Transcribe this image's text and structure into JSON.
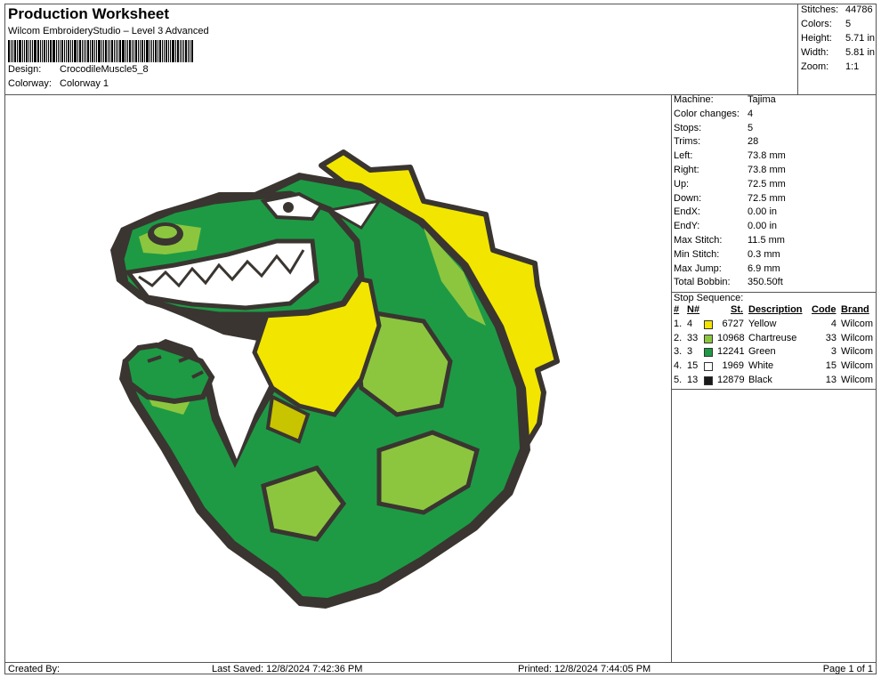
{
  "header": {
    "title": "Production Worksheet",
    "subtitle": "Wilcom EmbroideryStudio – Level 3 Advanced",
    "design_label": "Design:",
    "design_value": "CrocodileMuscle5_8",
    "colorway_label": "Colorway:",
    "colorway_value": "Colorway 1"
  },
  "stats": [
    {
      "label": "Stitches:",
      "value": "44786"
    },
    {
      "label": "Colors:",
      "value": "5"
    },
    {
      "label": "Height:",
      "value": "5.71 in"
    },
    {
      "label": "Width:",
      "value": "5.81 in"
    },
    {
      "label": "Zoom:",
      "value": "1:1"
    }
  ],
  "properties": [
    {
      "label": "Machine:",
      "value": "Tajima"
    },
    {
      "label": "Color changes:",
      "value": "4"
    },
    {
      "label": "Stops:",
      "value": "5"
    },
    {
      "label": "Trims:",
      "value": "28"
    },
    {
      "label": "Left:",
      "value": "73.8 mm"
    },
    {
      "label": "Right:",
      "value": "73.8 mm"
    },
    {
      "label": "Up:",
      "value": "72.5 mm"
    },
    {
      "label": "Down:",
      "value": "72.5 mm"
    },
    {
      "label": "EndX:",
      "value": "0.00 in"
    },
    {
      "label": "EndY:",
      "value": "0.00 in"
    },
    {
      "label": "Max Stitch:",
      "value": "11.5 mm"
    },
    {
      "label": "Min Stitch:",
      "value": "0.3 mm"
    },
    {
      "label": "Max Jump:",
      "value": "6.9 mm"
    },
    {
      "label": "Total Bobbin:",
      "value": "350.50ft"
    }
  ],
  "stop_sequence": {
    "title": "Stop Sequence:",
    "headers": {
      "num": "#",
      "n": "N#",
      "st": "St.",
      "desc": "Description",
      "code": "Code",
      "brand": "Brand"
    },
    "rows": [
      {
        "num": "1.",
        "n": "4",
        "color": "#f2e600",
        "st": "6727",
        "desc": "Yellow",
        "code": "4",
        "brand": "Wilcom"
      },
      {
        "num": "2.",
        "n": "33",
        "color": "#8cc63f",
        "st": "10968",
        "desc": "Chartreuse",
        "code": "33",
        "brand": "Wilcom"
      },
      {
        "num": "3.",
        "n": "3",
        "color": "#1e9a45",
        "st": "12241",
        "desc": "Green",
        "code": "3",
        "brand": "Wilcom"
      },
      {
        "num": "4.",
        "n": "15",
        "color": "#ffffff",
        "st": "1969",
        "desc": "White",
        "code": "15",
        "brand": "Wilcom"
      },
      {
        "num": "5.",
        "n": "13",
        "color": "#1a1a1a",
        "st": "12879",
        "desc": "Black",
        "code": "13",
        "brand": "Wilcom"
      }
    ]
  },
  "footer": {
    "created_by": "Created By:",
    "last_saved": "Last Saved: 12/8/2024 7:42:36 PM",
    "printed": "Printed: 12/8/2024 7:44:05 PM",
    "page": "Page 1 of 1"
  },
  "colors": {
    "yellow": "#f2e600",
    "chartreuse": "#8cc63f",
    "green": "#1e9a45",
    "white": "#ffffff",
    "black": "#3a3530"
  }
}
